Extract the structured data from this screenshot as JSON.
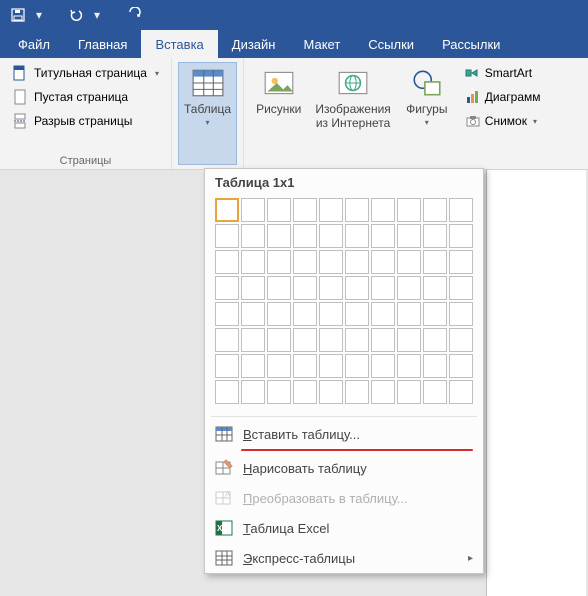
{
  "qat": {
    "save": "save",
    "undo": "undo",
    "redo": "redo"
  },
  "tabs": {
    "items": [
      "Файл",
      "Главная",
      "Вставка",
      "Дизайн",
      "Макет",
      "Ссылки",
      "Рассылки"
    ],
    "active_index": 2
  },
  "ribbon": {
    "pages": {
      "cover": "Титульная страница",
      "blank": "Пустая страница",
      "break": "Разрыв страницы",
      "group_label": "Страницы"
    },
    "table": {
      "label": "Таблица"
    },
    "illustrations": {
      "pictures": "Рисунки",
      "online_pictures_line1": "Изображения",
      "online_pictures_line2": "из Интернета",
      "shapes": "Фигуры",
      "smartart": "SmartArt",
      "chart": "Диаграмм",
      "screenshot": "Снимок"
    }
  },
  "popup": {
    "title": "Таблица 1x1",
    "grid": {
      "cols": 10,
      "rows": 8,
      "sel_cols": 1,
      "sel_rows": 1
    },
    "items": {
      "insert": "Вставить таблицу...",
      "draw": "Нарисовать таблицу",
      "convert": "Преобразовать в таблицу...",
      "excel": "Таблица Excel",
      "quick": "Экспресс-таблицы"
    }
  },
  "colors": {
    "brand": "#2b579a",
    "accent_orange": "#e8a53c",
    "green": "#217346",
    "red": "#d92b2b"
  }
}
